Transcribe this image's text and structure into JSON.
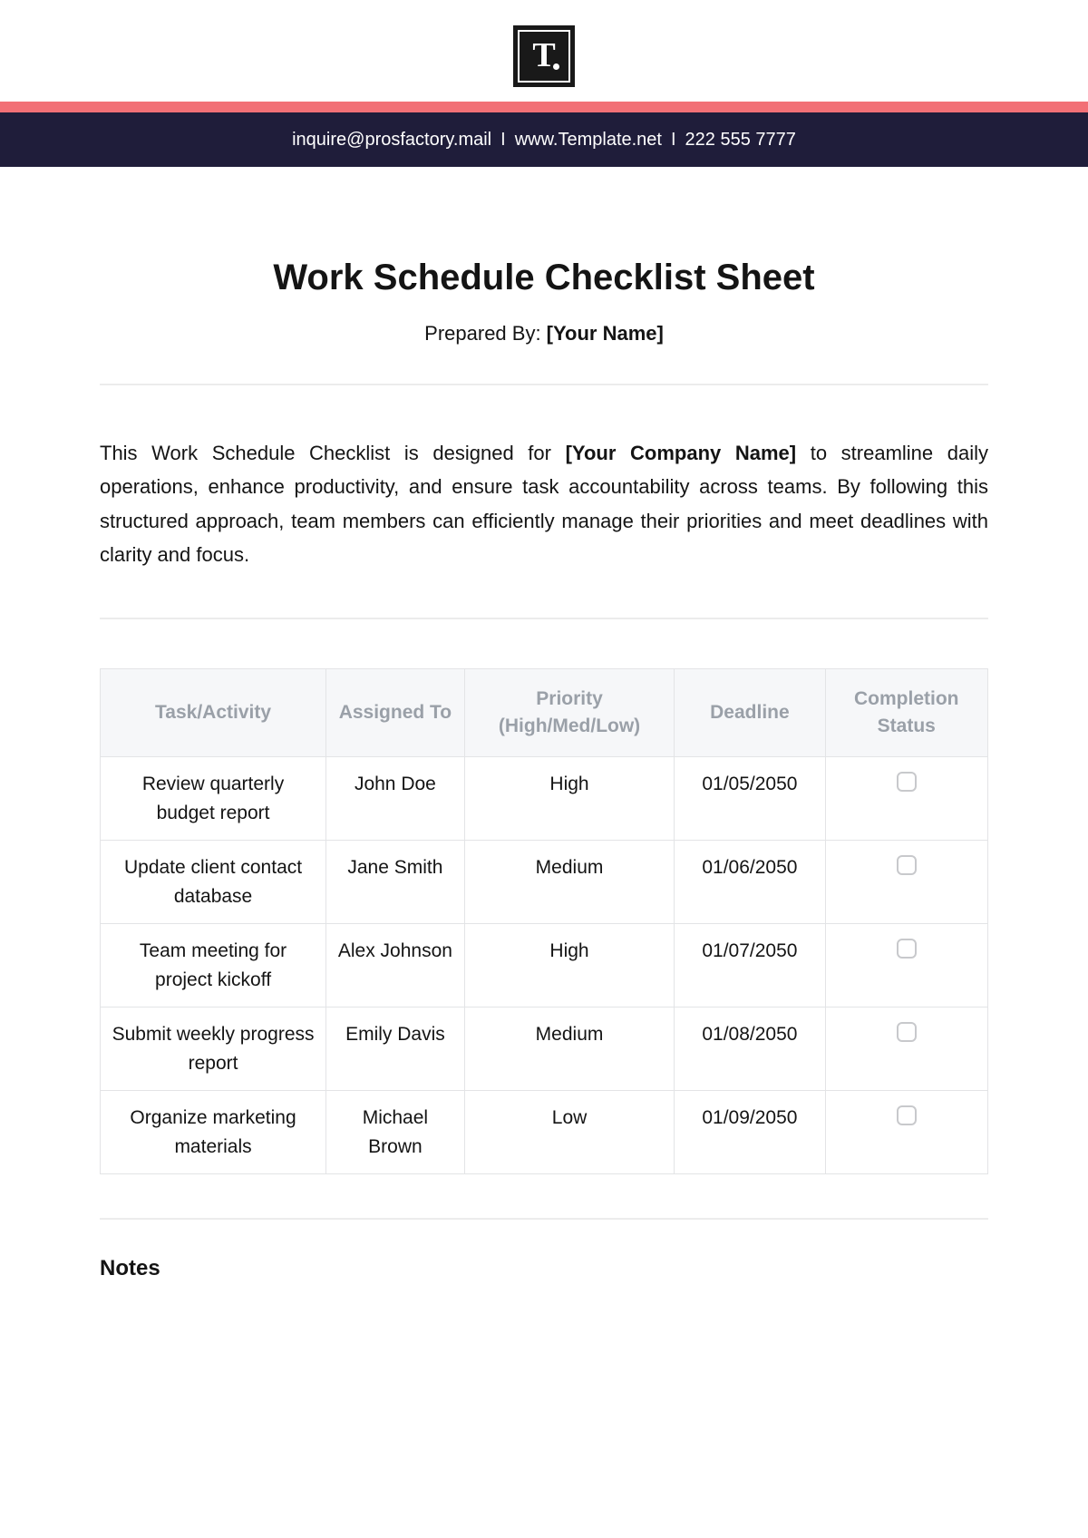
{
  "logo": {
    "letter": "T"
  },
  "contact": {
    "email": "inquire@prosfactory.mail",
    "website": "www.Template.net",
    "phone": "222 555 7777",
    "sep": "I"
  },
  "title": "Work Schedule Checklist Sheet",
  "prepared_label": "Prepared By: ",
  "prepared_value": "[Your Name]",
  "intro_pre": "This Work Schedule Checklist is designed for ",
  "intro_company": "[Your Company Name]",
  "intro_post": " to streamline daily operations, enhance productivity, and ensure task accountability across teams. By following this structured approach, team members can efficiently manage their priorities and meet deadlines with clarity and focus.",
  "table": {
    "headers": {
      "task": "Task/Activity",
      "assigned": "Assigned To",
      "priority": "Priority (High/Med/Low)",
      "deadline": "Deadline",
      "status": "Completion Status"
    },
    "rows": [
      {
        "task": "Review quarterly budget report",
        "assigned": "John Doe",
        "priority": "High",
        "deadline": "01/05/2050"
      },
      {
        "task": "Update client contact database",
        "assigned": "Jane Smith",
        "priority": "Medium",
        "deadline": "01/06/2050"
      },
      {
        "task": "Team meeting for project kickoff",
        "assigned": "Alex Johnson",
        "priority": "High",
        "deadline": "01/07/2050"
      },
      {
        "task": "Submit weekly progress report",
        "assigned": "Emily Davis",
        "priority": "Medium",
        "deadline": "01/08/2050"
      },
      {
        "task": "Organize marketing materials",
        "assigned": "Michael Brown",
        "priority": "Low",
        "deadline": "01/09/2050"
      }
    ]
  },
  "notes_heading": "Notes"
}
